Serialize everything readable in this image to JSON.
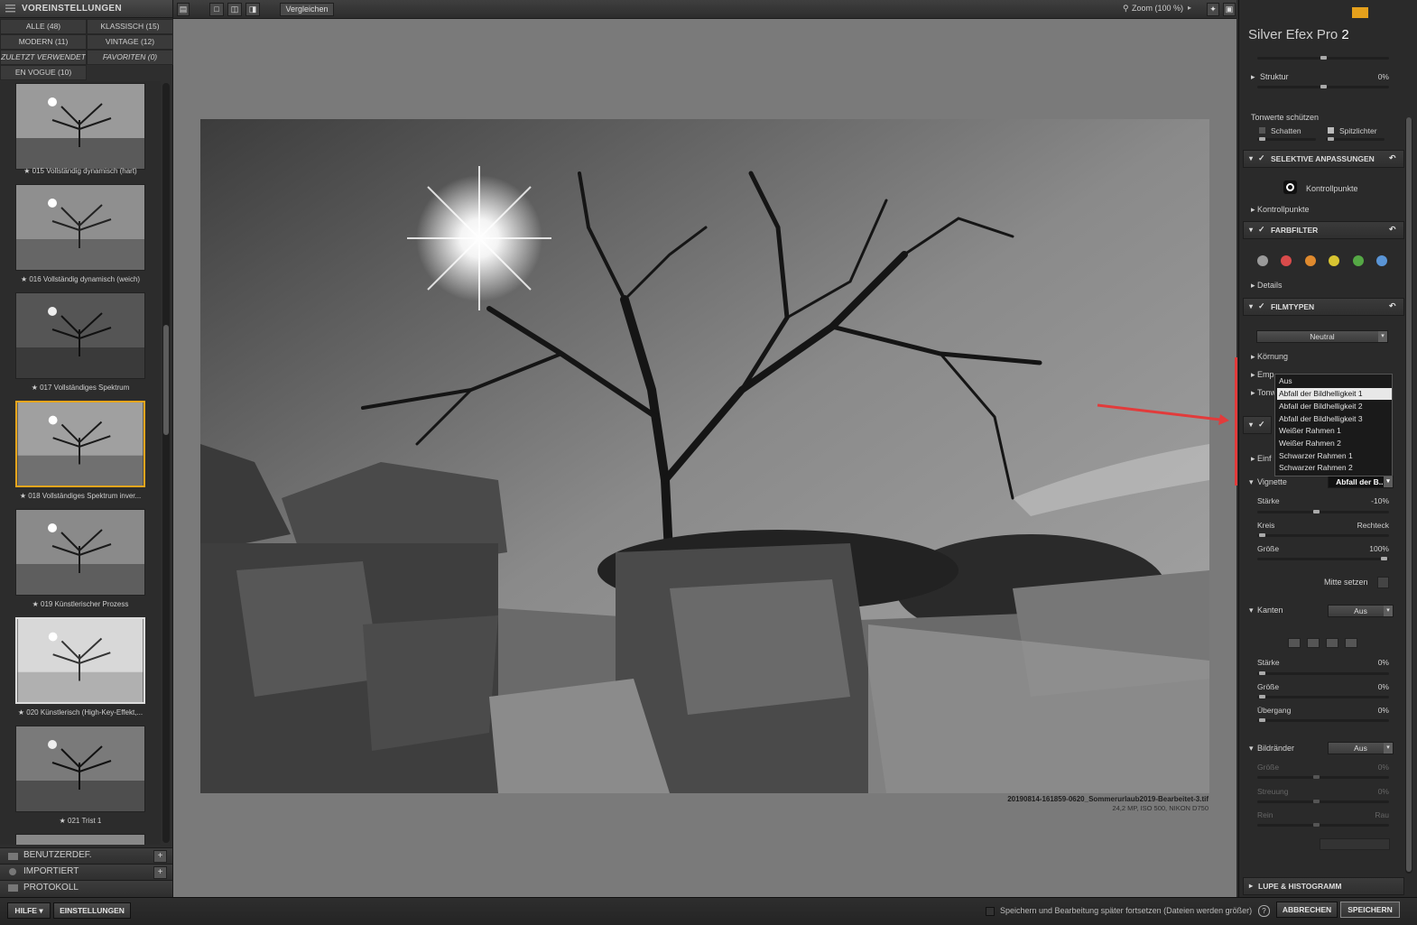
{
  "left_panel": {
    "title": "VOREINSTELLUNGEN",
    "categories": [
      {
        "label": "ALLE (48)"
      },
      {
        "label": "KLASSISCH (15)"
      },
      {
        "label": "MODERN (11)"
      },
      {
        "label": "VINTAGE (12)"
      },
      {
        "label": "ZULETZT VERWENDET"
      },
      {
        "label": "FAVORITEN (0)"
      },
      {
        "label": "EN VOGUE (10)"
      }
    ],
    "presets": [
      {
        "label": "★ 015 Vollständig dynamisch (hart)"
      },
      {
        "label": "★ 016 Vollständig dynamisch (weich)"
      },
      {
        "label": "★ 017 Vollständiges Spektrum"
      },
      {
        "label": "★ 018 Vollständiges Spektrum inver..."
      },
      {
        "label": "★ 019 Künstlerischer Prozess"
      },
      {
        "label": "★ 020 Künstlerisch (High-Key-Effekt,..."
      },
      {
        "label": "★ 021 Trist 1"
      }
    ],
    "sections": [
      {
        "label": "BENUTZERDEF."
      },
      {
        "label": "IMPORTIERT"
      },
      {
        "label": "PROTOKOLL"
      }
    ]
  },
  "toolbar": {
    "compare_label": "Vergleichen",
    "zoom_label": "Zoom (100 %)"
  },
  "image": {
    "filename": "20190814-161859-0620_Sommerurlaub2019-Bearbeitet-3.tif",
    "meta": "24,2 MP, ISO 500, NIKON D750"
  },
  "right_panel": {
    "brand_prefix": "Silver Efex Pro",
    "brand_version": "2",
    "struktur_label": "Struktur",
    "struktur_value": "0%",
    "tonwerte_label": "Tonwerte schützen",
    "schatten_label": "Schatten",
    "spitzlichter_label": "Spitzlichter",
    "selektive_label": "SELEKTIVE ANPASSUNGEN",
    "kontrollpunkte_btn": "Kontrollpunkte",
    "kontrollpunkte_row": "Kontrollpunkte",
    "farbfilter_label": "FARBFILTER",
    "filter_colors": [
      "#9a9a9a",
      "#d94b4b",
      "#e08a2e",
      "#d8c431",
      "#55a845",
      "#5a95d6"
    ],
    "details_label": "Details",
    "filmtypen_label": "FILMTYPEN",
    "film_value": "Neutral",
    "koernung_label": "Körnung",
    "emp_label": "Emp",
    "tonw_label": "Tonw",
    "einf_label": "Einf",
    "vignette_label": "Vignette",
    "vignette_value": "Abfall der B...",
    "staerke_label": "Stärke",
    "staerke_value": "-10%",
    "kreis_label": "Kreis",
    "rechteck_label": "Rechteck",
    "groesse_label": "Größe",
    "groesse_value": "100%",
    "mitte_label": "Mitte setzen",
    "kanten_label": "Kanten",
    "kanten_value": "Aus",
    "k_staerke_label": "Stärke",
    "k_staerke_value": "0%",
    "k_groesse_label": "Größe",
    "k_groesse_value": "0%",
    "uebergang_label": "Übergang",
    "uebergang_value": "0%",
    "bildraender_label": "Bildränder",
    "bildraender_value": "Aus",
    "b_groesse_label": "Größe",
    "b_groesse_value": "0%",
    "streuung_label": "Streuung",
    "streuung_value": "0%",
    "rein_label": "Rein",
    "rau_label": "Rau",
    "lupe_label": "LUPE & HISTOGRAMM",
    "dropdown_items": [
      {
        "label": "Aus"
      },
      {
        "label": "Abfall der Bildhelligkeit 1"
      },
      {
        "label": "Abfall der Bildhelligkeit 2"
      },
      {
        "label": "Abfall der Bildhelligkeit 3"
      },
      {
        "label": "Weißer Rahmen 1"
      },
      {
        "label": "Weißer Rahmen 2"
      },
      {
        "label": "Schwarzer Rahmen 1"
      },
      {
        "label": "Schwarzer Rahmen 2"
      }
    ]
  },
  "bottom": {
    "help_label": "HILFE ▾",
    "settings_label": "EINSTELLUNGEN",
    "save_later_label": "Speichern und Bearbeitung später fortsetzen (Dateien werden größer)",
    "cancel_label": "ABBRECHEN",
    "save_label": "SPEICHERN"
  }
}
